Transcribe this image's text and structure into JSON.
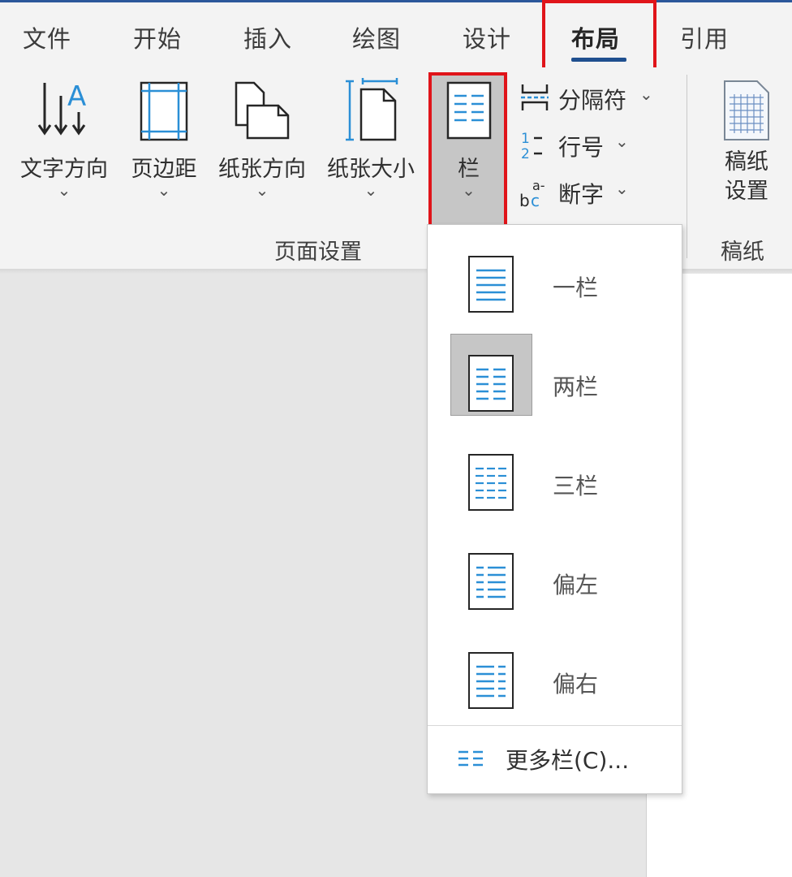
{
  "tabs": [
    "文件",
    "开始",
    "插入",
    "绘图",
    "设计",
    "布局",
    "引用"
  ],
  "ribbon": {
    "page_setup": {
      "label": "页面设置",
      "buttons": [
        "文字方向",
        "页边距",
        "纸张方向",
        "纸张大小"
      ],
      "columns_label": "栏",
      "small_buttons": [
        "分隔符",
        "行号",
        "断字"
      ]
    },
    "draft_paper": {
      "label": "稿纸",
      "button_line1": "稿纸",
      "button_line2": "设置"
    }
  },
  "columns_menu": {
    "items": [
      "一栏",
      "两栏",
      "三栏",
      "偏左",
      "偏右"
    ],
    "selected": "两栏",
    "more": "更多栏(C)..."
  },
  "colors": {
    "accent": "#2b579a",
    "highlight_box": "#e0141a",
    "icon_blue": "#2b8fd6"
  }
}
